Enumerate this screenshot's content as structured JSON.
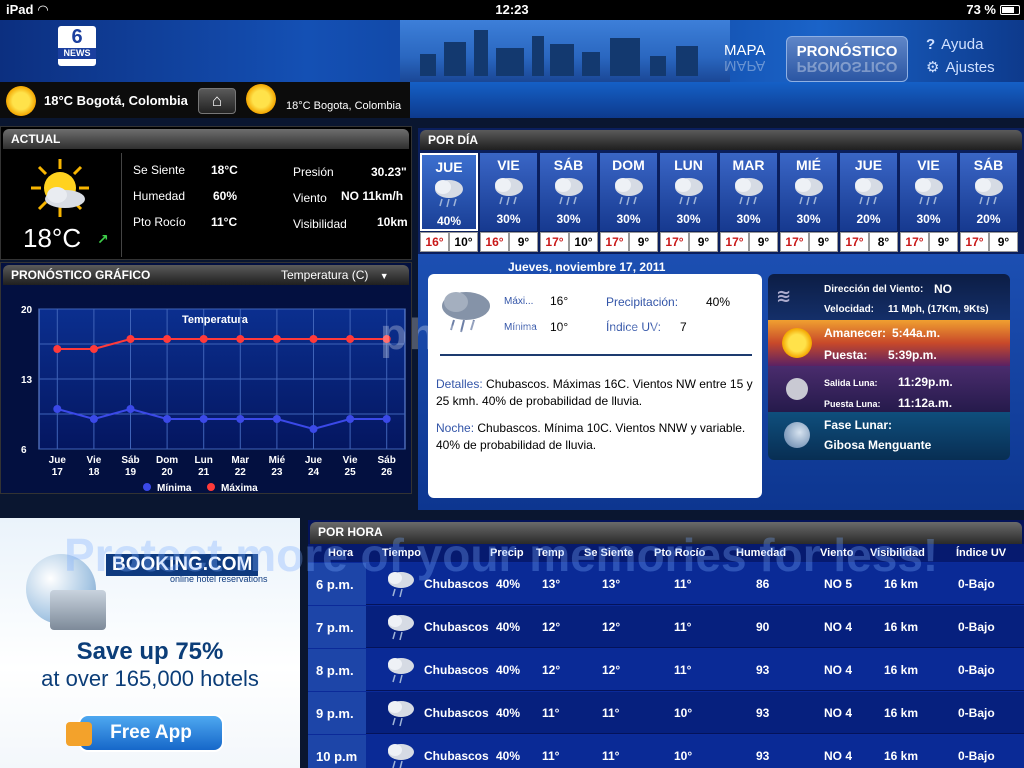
{
  "status": {
    "device": "iPad",
    "time": "12:23",
    "battery": "73 %",
    "battery_level": 0.73
  },
  "header": {
    "logo_number": "6",
    "logo_text": "NEWS",
    "nav": {
      "mapa": "MAPA",
      "pronostico": "PRONÓSTICO",
      "ayuda": "Ayuda",
      "ajustes": "Ajustes"
    }
  },
  "location": {
    "current": "18°C  Bogotá, Colombia",
    "secondary": "18°C Bogota, Colombia"
  },
  "actual": {
    "title": "ACTUAL",
    "temp": "18°C",
    "labels": {
      "feels": "Se Siente",
      "humidity": "Humedad",
      "dew": "Pto Rocío",
      "pressure": "Presión",
      "wind": "Viento",
      "visibility": "Visibilidad"
    },
    "values": {
      "feels": "18°C",
      "humidity": "60%",
      "dew": "11°C",
      "pressure": "30.23\"",
      "wind": "NO 11km/h",
      "visibility": "10km"
    }
  },
  "grafico": {
    "title": "PRONÓSTICO GRÁFICO",
    "selector": "Temperatura (C)",
    "plot_title": "Temperatura",
    "legend_min": "Mínima",
    "legend_max": "Máxima"
  },
  "chart_data": {
    "type": "line",
    "title": "Temperatura",
    "categories": [
      "Jue 17",
      "Vie 18",
      "Sáb 19",
      "Dom 20",
      "Lun 21",
      "Mar 22",
      "Mié 23",
      "Jue 24",
      "Vie 25",
      "Sáb 26"
    ],
    "yticks": [
      "20",
      "13",
      "6"
    ],
    "ylim": [
      6,
      20
    ],
    "series": [
      {
        "name": "Máxima",
        "color": "#ff3a3a",
        "values": [
          16,
          16,
          17,
          17,
          17,
          17,
          17,
          17,
          17,
          17
        ]
      },
      {
        "name": "Mínima",
        "color": "#3b49e8",
        "values": [
          10,
          9,
          10,
          9,
          9,
          9,
          9,
          8,
          9,
          9
        ]
      }
    ]
  },
  "pordia": {
    "title": "POR DÍA",
    "days": [
      {
        "d": "JUE",
        "p": "40%",
        "hi": "16°",
        "lo": "10°"
      },
      {
        "d": "VIE",
        "p": "30%",
        "hi": "16°",
        "lo": "9°"
      },
      {
        "d": "SÁB",
        "p": "30%",
        "hi": "17°",
        "lo": "10°"
      },
      {
        "d": "DOM",
        "p": "30%",
        "hi": "17°",
        "lo": "9°"
      },
      {
        "d": "LUN",
        "p": "30%",
        "hi": "17°",
        "lo": "9°"
      },
      {
        "d": "MAR",
        "p": "30%",
        "hi": "17°",
        "lo": "9°"
      },
      {
        "d": "MIÉ",
        "p": "30%",
        "hi": "17°",
        "lo": "9°"
      },
      {
        "d": "JUE",
        "p": "20%",
        "hi": "17°",
        "lo": "8°"
      },
      {
        "d": "VIE",
        "p": "30%",
        "hi": "17°",
        "lo": "9°"
      },
      {
        "d": "SÁB",
        "p": "20%",
        "hi": "17°",
        "lo": "9°"
      }
    ],
    "date": "Jueves, noviembre 17, 2011",
    "detail": {
      "max_label": "Máxi...",
      "max": "16°",
      "min_label": "Mínima",
      "min": "10°",
      "precip_label": "Precipitación:",
      "precip": "40%",
      "uv_label": "Índice UV:",
      "uv": "7",
      "detalles_label": "Detalles:",
      "detalles": "Chubascos. Máximas 16C. Vientos NW entre 15 y 25 kmh. 40% de probabilidad de lluvia.",
      "noche_label": "Noche:",
      "noche": "Chubascos. Mínima 10C. Vientos NNW y variable. 40% de probabilidad de lluvia."
    },
    "astro": {
      "wind_dir_label": "Dirección del Viento:",
      "wind_dir": "NO",
      "speed_label": "Velocidad:",
      "speed": "11 Mph, (17Km, 9Kts)",
      "sunrise_label": "Amanecer:",
      "sunrise": "5:44a.m.",
      "sunset_label": "Puesta:",
      "sunset": "5:39p.m.",
      "moonrise_label": "Salida Luna:",
      "moonrise": "11:29p.m.",
      "moonset_label": "Puesta Luna:",
      "moonset": "11:12a.m.",
      "phase_label": "Fase Lunar:",
      "phase": "Gibosa Menguante"
    }
  },
  "porhora": {
    "title": "POR HORA",
    "headers": [
      "Hora",
      "Tiempo",
      "Precip",
      "Temp",
      "Se Siente",
      "Pto Rocío",
      "Humedad",
      "Viento",
      "Visibilidad",
      "Índice UV"
    ],
    "rows": [
      {
        "h": "6 p.m.",
        "t": "Chubascos",
        "p": "40%",
        "temp": "13°",
        "f": "13°",
        "dp": "11°",
        "hu": "86",
        "w": "NO 5",
        "v": "16 km",
        "uv": "0-Bajo"
      },
      {
        "h": "7 p.m.",
        "t": "Chubascos",
        "p": "40%",
        "temp": "12°",
        "f": "12°",
        "dp": "11°",
        "hu": "90",
        "w": "NO 4",
        "v": "16 km",
        "uv": "0-Bajo"
      },
      {
        "h": "8 p.m.",
        "t": "Chubascos",
        "p": "40%",
        "temp": "12°",
        "f": "12°",
        "dp": "11°",
        "hu": "93",
        "w": "NO 4",
        "v": "16 km",
        "uv": "0-Bajo"
      },
      {
        "h": "9 p.m.",
        "t": "Chubascos",
        "p": "40%",
        "temp": "11°",
        "f": "11°",
        "dp": "10°",
        "hu": "93",
        "w": "NO 4",
        "v": "16 km",
        "uv": "0-Bajo"
      },
      {
        "h": "10 p.m",
        "t": "Chubascos",
        "p": "40%",
        "temp": "11°",
        "f": "11°",
        "dp": "10°",
        "hu": "93",
        "w": "NO 4",
        "v": "16 km",
        "uv": "0-Bajo"
      }
    ]
  },
  "ad": {
    "brand": "BOOKING.COM",
    "tagline": "online hotel reservations",
    "line1": "Save up 75%",
    "line2": "at over 165,000 hotels",
    "cta": "Free App"
  },
  "watermark": {
    "top": "photobucket",
    "bottom": "Protect more of your memories for less!"
  }
}
